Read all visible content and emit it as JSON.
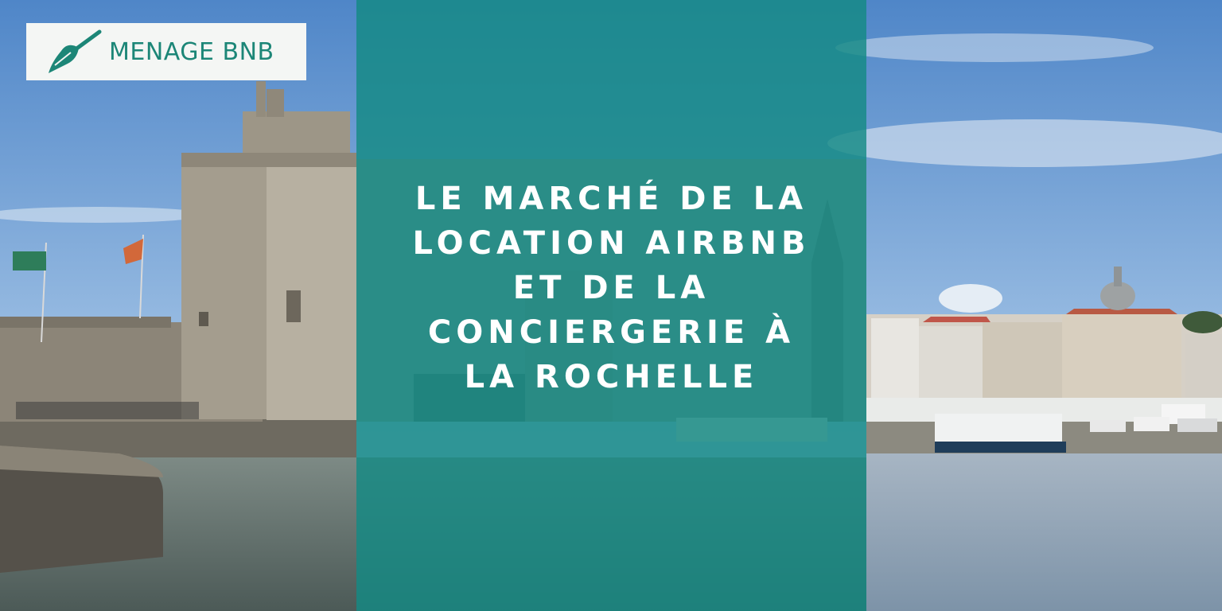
{
  "logo": {
    "text": "MENAGE BNB",
    "icon": "broom-icon",
    "brand_color": "#1c8677"
  },
  "headline": {
    "lines": [
      "LE MARCHÉ DE LA",
      "LOCATION AIRBNB",
      "ET DE LA",
      "CONCIERGERIE À",
      "LA ROCHELLE"
    ]
  },
  "overlay": {
    "color": "#148a84"
  }
}
